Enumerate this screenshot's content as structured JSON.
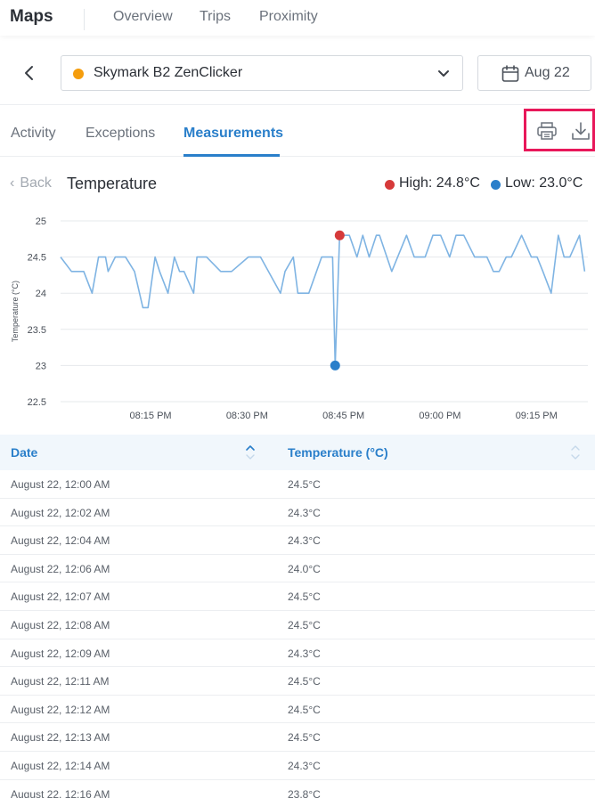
{
  "app": {
    "title": "Maps"
  },
  "nav": {
    "items": [
      "Overview",
      "Trips",
      "Proximity"
    ]
  },
  "device": {
    "name": "Skymark B2 ZenClicker",
    "status_color": "#f59d0d"
  },
  "date_picker": {
    "label": "Aug 22"
  },
  "tabs": {
    "items": [
      "Activity",
      "Exceptions",
      "Measurements"
    ],
    "active": "Measurements"
  },
  "chart_header": {
    "back_label": "Back",
    "title": "Temperature",
    "high": "High: 24.8°C",
    "low": "Low: 23.0°C",
    "high_color": "#d63a3a",
    "low_color": "#2a7fca"
  },
  "chart_data": {
    "type": "line",
    "ylabel": "Temperature (°C)",
    "ylim": [
      22.5,
      25
    ],
    "yticks": [
      "25",
      "24.5",
      "24",
      "23.5",
      "23",
      "22.5"
    ],
    "xticks": [
      "08:15 PM",
      "08:30 PM",
      "08:45 PM",
      "09:00 PM",
      "09:15 PM"
    ],
    "xlim_minutes": [
      0,
      82
    ],
    "xtick_minutes": [
      14,
      29,
      44,
      59,
      74
    ],
    "line_color": "#7fb4e3",
    "grid": true,
    "series": [
      {
        "x": [
          0,
          1.7,
          3.6,
          4.9,
          5.9,
          7.0,
          7.4,
          8.5,
          10.1,
          11.5,
          12.8,
          13.6,
          14.7,
          15.4,
          16.7,
          17.7,
          18.5,
          19.2,
          20.7,
          21.2,
          22.3,
          22.7,
          24.9,
          26.6,
          29.2,
          31.1,
          34.2,
          34.9,
          36.2,
          36.9,
          38.6,
          40.6,
          42.3,
          42.7,
          43.4,
          44.9,
          46.1,
          47.0,
          48.0,
          49.1,
          49.6,
          51.5,
          53.8,
          55.0,
          56.7,
          57.9,
          59.1,
          60.5,
          61.5,
          62.7,
          64.4,
          66.3,
          67.3,
          68.2,
          69.3,
          70.1,
          71.7,
          73.2,
          74.1,
          75.0,
          76.3,
          77.4,
          78.3,
          79.2,
          80.7,
          81.5
        ],
        "y": [
          24.5,
          24.3,
          24.3,
          24.0,
          24.5,
          24.5,
          24.3,
          24.5,
          24.5,
          24.3,
          23.8,
          23.8,
          24.5,
          24.3,
          24.0,
          24.5,
          24.3,
          24.3,
          24.0,
          24.5,
          24.5,
          24.5,
          24.3,
          24.3,
          24.5,
          24.5,
          24.0,
          24.3,
          24.5,
          24.0,
          24.0,
          24.5,
          24.5,
          23.0,
          24.8,
          24.8,
          24.5,
          24.8,
          24.5,
          24.8,
          24.8,
          24.3,
          24.8,
          24.5,
          24.5,
          24.8,
          24.8,
          24.5,
          24.8,
          24.8,
          24.5,
          24.5,
          24.3,
          24.3,
          24.5,
          24.5,
          24.8,
          24.5,
          24.5,
          24.3,
          24.0,
          24.8,
          24.5,
          24.5,
          24.8,
          24.3
        ]
      }
    ],
    "markers": [
      {
        "x": 42.7,
        "y": 23.0,
        "color": "#2a7fca"
      },
      {
        "x": 43.4,
        "y": 24.8,
        "color": "#d63a3a"
      }
    ]
  },
  "table": {
    "columns": [
      "Date",
      "Temperature (°C)"
    ],
    "rows": [
      [
        "August 22, 12:00 AM",
        "24.5°C"
      ],
      [
        "August 22, 12:02 AM",
        "24.3°C"
      ],
      [
        "August 22, 12:04 AM",
        "24.3°C"
      ],
      [
        "August 22, 12:06 AM",
        "24.0°C"
      ],
      [
        "August 22, 12:07 AM",
        "24.5°C"
      ],
      [
        "August 22, 12:08 AM",
        "24.5°C"
      ],
      [
        "August 22, 12:09 AM",
        "24.3°C"
      ],
      [
        "August 22, 12:11 AM",
        "24.5°C"
      ],
      [
        "August 22, 12:12 AM",
        "24.5°C"
      ],
      [
        "August 22, 12:13 AM",
        "24.5°C"
      ],
      [
        "August 22, 12:14 AM",
        "24.3°C"
      ],
      [
        "August 22, 12:16 AM",
        "23.8°C"
      ]
    ]
  },
  "icons": {
    "back": "chevron-left-icon",
    "select": "chevron-down-icon",
    "calendar": "calendar-icon",
    "print": "printer-icon",
    "download": "download-icon",
    "sort": "sort-icon"
  },
  "highlight_color": "#e8185a"
}
